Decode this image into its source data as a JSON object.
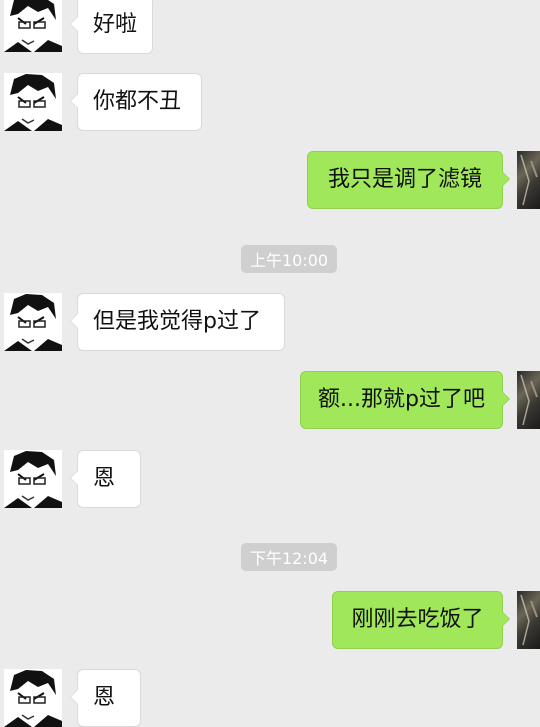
{
  "messages": [
    {
      "side": "in",
      "text": "好啦"
    },
    {
      "side": "in",
      "text": "你都不丑"
    },
    {
      "side": "out",
      "text": "我只是调了滤镜"
    },
    {
      "type": "time",
      "text": "上午10:00"
    },
    {
      "side": "in",
      "text": "但是我觉得p过了"
    },
    {
      "side": "out",
      "text": "额...那就p过了吧"
    },
    {
      "side": "in",
      "text": "恩"
    },
    {
      "type": "time",
      "text": "下午12:04"
    },
    {
      "side": "out",
      "text": "刚刚去吃饭了"
    },
    {
      "side": "in",
      "text": "恩"
    }
  ],
  "colors": {
    "background": "#ebebeb",
    "incoming_bubble": "#ffffff",
    "outgoing_bubble": "#a0e75a",
    "timestamp_pill": "#cfcfcf"
  }
}
